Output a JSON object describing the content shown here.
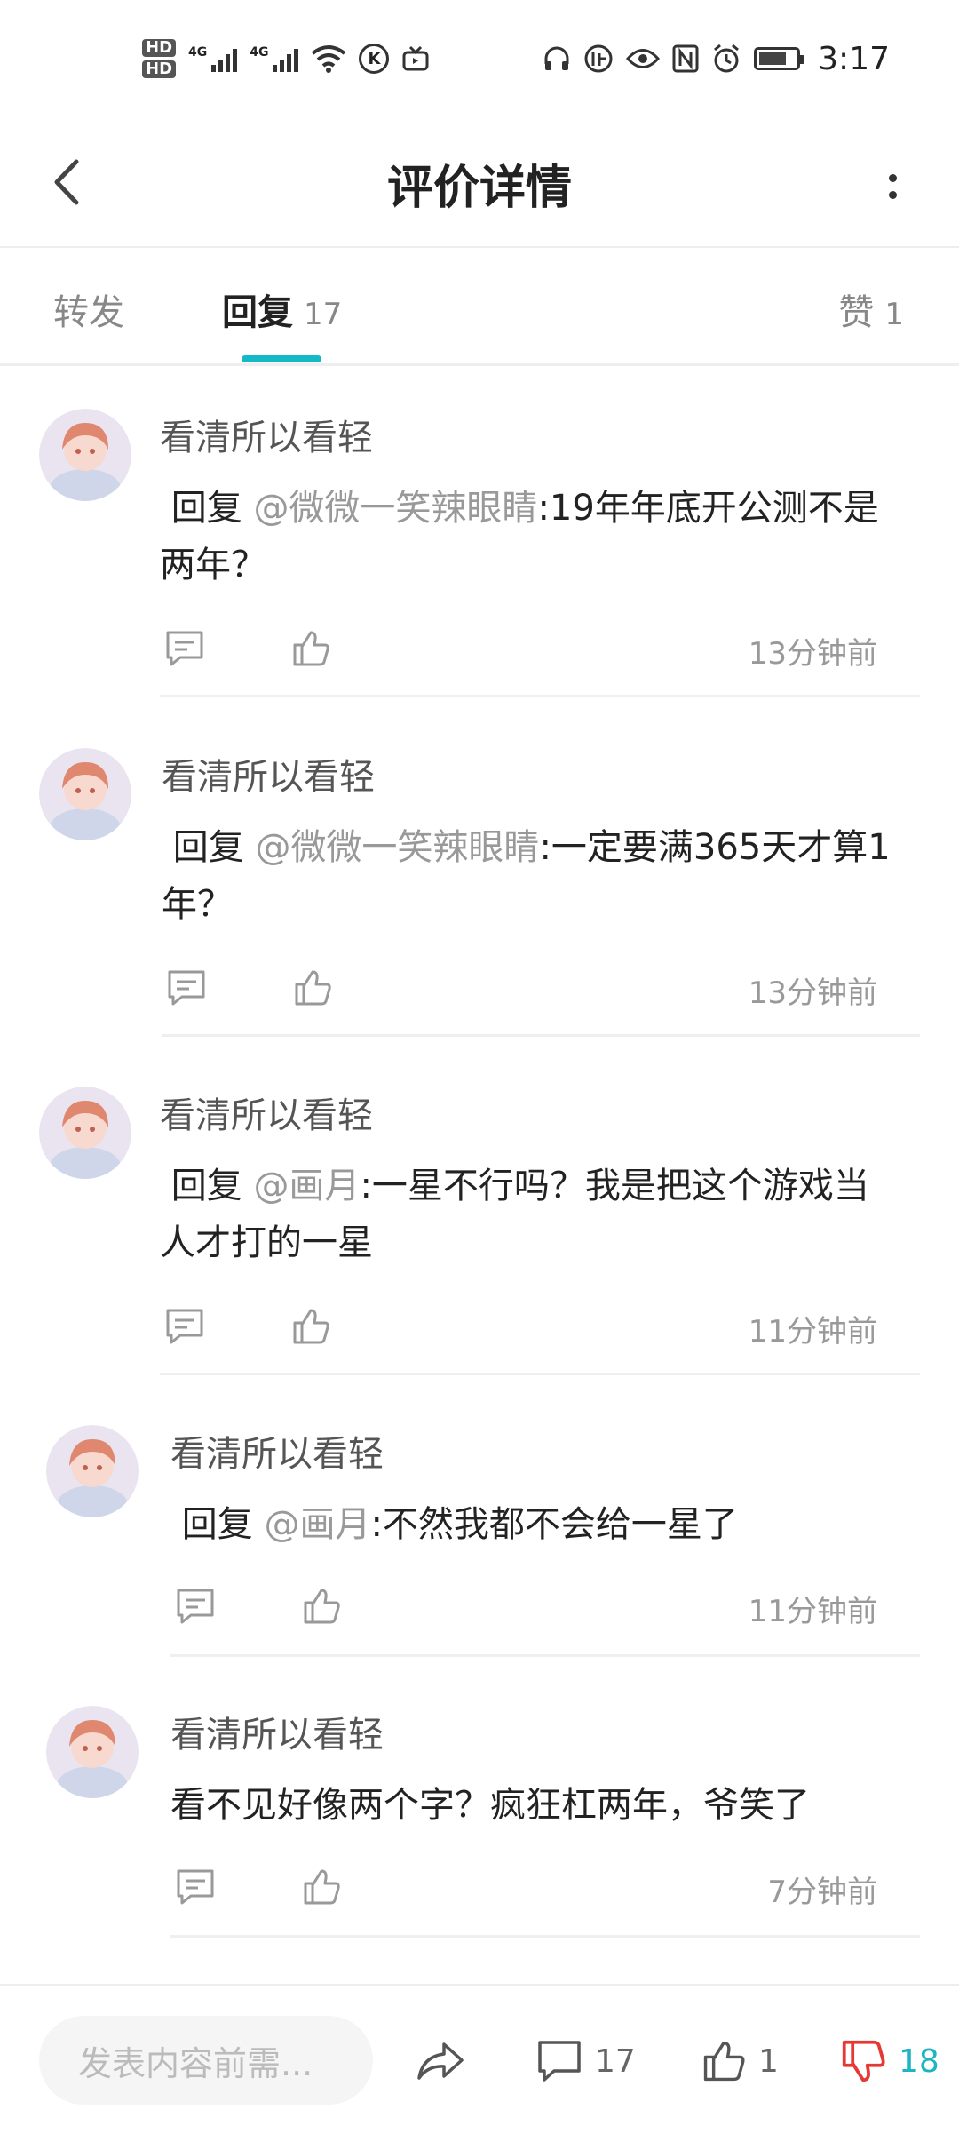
{
  "status_bar": {
    "hd1": "HD",
    "hd2": "HD",
    "net1": "4G",
    "net2": "4G",
    "k_icon_label": "K",
    "time": "3:17"
  },
  "header": {
    "title": "评价详情",
    "back_icon": "chevron-left-icon",
    "more_icon": "more-vertical-icon"
  },
  "tabs": {
    "repost_label": "转发",
    "reply_label": "回复",
    "reply_count": "17",
    "like_label": "赞",
    "like_count": "1",
    "accent_color": "#14b9c8"
  },
  "comments": [
    {
      "username": "看清所以看轻",
      "prefix": "回复 ",
      "mention": "@微微一笑辣眼睛",
      "text_line1": ":19年年底开公测不是",
      "text_line2": "两年？",
      "time": "13分钟前"
    },
    {
      "username": "看清所以看轻",
      "prefix": "回复 ",
      "mention": "@微微一笑辣眼睛",
      "text_line1": ":一定要满365天才算1",
      "text_line2": "年？",
      "time": "13分钟前"
    },
    {
      "username": "看清所以看轻",
      "prefix": "回复 ",
      "mention": "@画月",
      "text_line1": ":一星不行吗？我是把这个游戏当",
      "text_line2": "人才打的一星",
      "time": "11分钟前"
    },
    {
      "username": "看清所以看轻",
      "prefix": "回复 ",
      "mention": "@画月",
      "text_line1": ":不然我都不会给一星了",
      "text_line2": "",
      "time": "11分钟前"
    },
    {
      "username": "看清所以看轻",
      "prefix": "",
      "mention": "",
      "text_line1": "看不见好像两个字？疯狂杠两年，爷笑了",
      "text_line2": "",
      "time": "7分钟前"
    }
  ],
  "bottom_bar": {
    "input_placeholder": "发表内容前需...",
    "comment_count": "17",
    "like_count": "1",
    "dislike_count": "18",
    "dislike_color": "#e53935",
    "count_accent": "#1eb5c2"
  }
}
